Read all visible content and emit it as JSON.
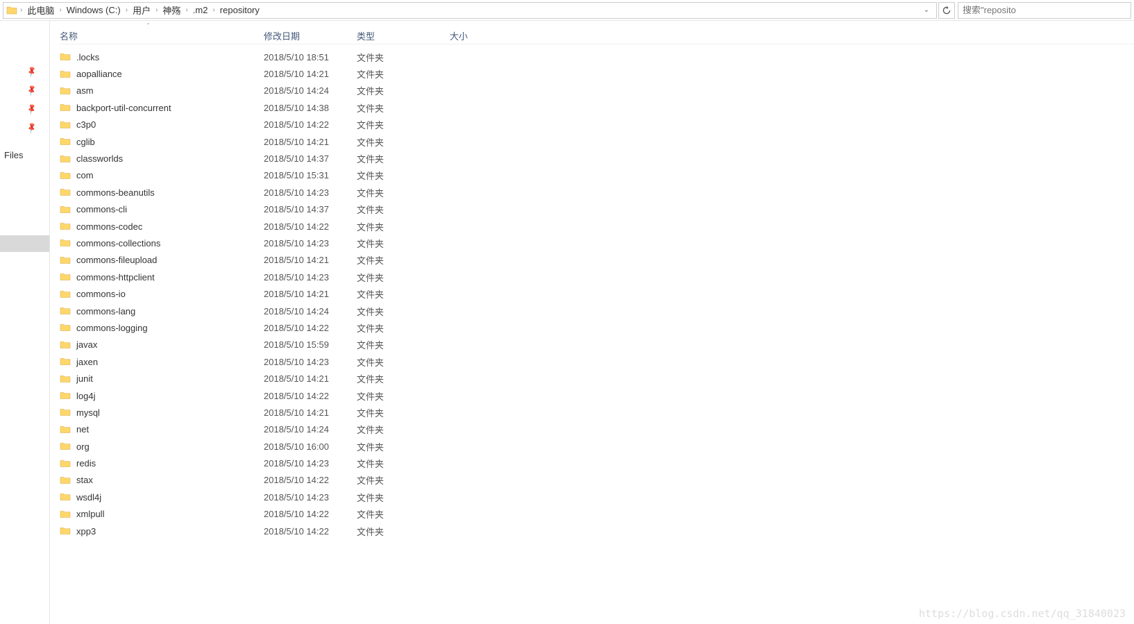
{
  "breadcrumb": [
    "此电脑",
    "Windows (C:)",
    "用户",
    "神殇",
    ".m2",
    "repository"
  ],
  "search": {
    "placeholder": "搜索\"reposito"
  },
  "sidebar": {
    "files_label": "Files"
  },
  "columns": {
    "name": "名称",
    "date": "修改日期",
    "type": "类型",
    "size": "大小"
  },
  "type_label": "文件夹",
  "items": [
    {
      "name": ".locks",
      "date": "2018/5/10 18:51"
    },
    {
      "name": "aopalliance",
      "date": "2018/5/10 14:21"
    },
    {
      "name": "asm",
      "date": "2018/5/10 14:24"
    },
    {
      "name": "backport-util-concurrent",
      "date": "2018/5/10 14:38"
    },
    {
      "name": "c3p0",
      "date": "2018/5/10 14:22"
    },
    {
      "name": "cglib",
      "date": "2018/5/10 14:21"
    },
    {
      "name": "classworlds",
      "date": "2018/5/10 14:37"
    },
    {
      "name": "com",
      "date": "2018/5/10 15:31"
    },
    {
      "name": "commons-beanutils",
      "date": "2018/5/10 14:23"
    },
    {
      "name": "commons-cli",
      "date": "2018/5/10 14:37"
    },
    {
      "name": "commons-codec",
      "date": "2018/5/10 14:22"
    },
    {
      "name": "commons-collections",
      "date": "2018/5/10 14:23"
    },
    {
      "name": "commons-fileupload",
      "date": "2018/5/10 14:21"
    },
    {
      "name": "commons-httpclient",
      "date": "2018/5/10 14:23"
    },
    {
      "name": "commons-io",
      "date": "2018/5/10 14:21"
    },
    {
      "name": "commons-lang",
      "date": "2018/5/10 14:24"
    },
    {
      "name": "commons-logging",
      "date": "2018/5/10 14:22"
    },
    {
      "name": "javax",
      "date": "2018/5/10 15:59"
    },
    {
      "name": "jaxen",
      "date": "2018/5/10 14:23"
    },
    {
      "name": "junit",
      "date": "2018/5/10 14:21"
    },
    {
      "name": "log4j",
      "date": "2018/5/10 14:22"
    },
    {
      "name": "mysql",
      "date": "2018/5/10 14:21"
    },
    {
      "name": "net",
      "date": "2018/5/10 14:24"
    },
    {
      "name": "org",
      "date": "2018/5/10 16:00"
    },
    {
      "name": "redis",
      "date": "2018/5/10 14:23"
    },
    {
      "name": "stax",
      "date": "2018/5/10 14:22"
    },
    {
      "name": "wsdl4j",
      "date": "2018/5/10 14:23"
    },
    {
      "name": "xmlpull",
      "date": "2018/5/10 14:22"
    },
    {
      "name": "xpp3",
      "date": "2018/5/10 14:22"
    }
  ],
  "watermark": "https://blog.csdn.net/qq_31840023"
}
